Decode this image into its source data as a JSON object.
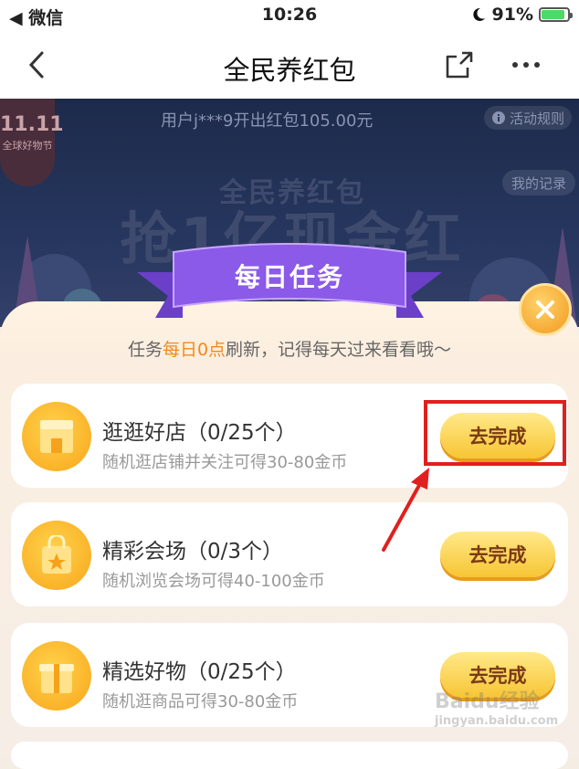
{
  "status_bar": {
    "carrier": "◀ 微信",
    "time": "10:26",
    "battery_percent": "91%",
    "battery_level": 0.91
  },
  "nav": {
    "title": "全民养红包"
  },
  "banner": {
    "notice": "用户j***9开出红包105.00元",
    "rules_label": "活动规则",
    "records_label": "我的记录",
    "badge_top": "11.11",
    "badge_bottom": "全球好物节",
    "headline_small": "全民养红包",
    "headline_big": "抢1亿现金红包"
  },
  "panel": {
    "title": "每日任务",
    "subtitle_pre": "任务",
    "subtitle_highlight": "每日0点",
    "subtitle_post": "刷新，记得每天过来看看哦～"
  },
  "tasks": [
    {
      "name": "逛逛好店（0/25个）",
      "desc": "随机逛店铺并关注可得30-80金币",
      "button": "去完成",
      "icon": "shop-icon"
    },
    {
      "name": "精彩会场（0/3个）",
      "desc": "随机浏览会场可得40-100金币",
      "button": "去完成",
      "icon": "shopping-bag-icon"
    },
    {
      "name": "精选好物（0/25个）",
      "desc": "随机逛商品可得30-80金币",
      "button": "去完成",
      "icon": "gift-icon"
    }
  ],
  "colors": {
    "accent": "#f08a1a",
    "highlight_box": "#e0201e",
    "button": "#f7c534"
  },
  "watermark": {
    "line1": "Baidu经验",
    "line2": "jingyan.baidu.com"
  }
}
